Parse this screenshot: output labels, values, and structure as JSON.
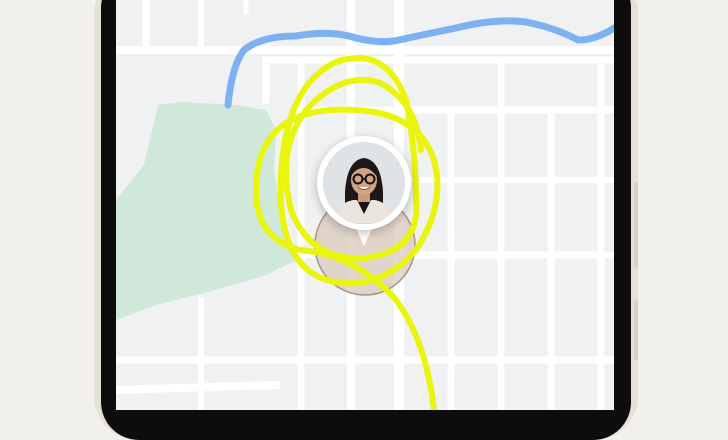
{
  "app": {
    "screen": "find-my-location-map",
    "colors": {
      "map_background": "#f0f1f3",
      "roads": "#ffffff",
      "park": "#cfe8d9",
      "river": "#7eb1f2",
      "accuracy_circle": "#d8c8b8",
      "scribble": "#e9f50a",
      "phone_frame": "#e6e1d6",
      "bezel": "#0d0d0d"
    },
    "pin": {
      "icon": "person-avatar-icon"
    }
  }
}
